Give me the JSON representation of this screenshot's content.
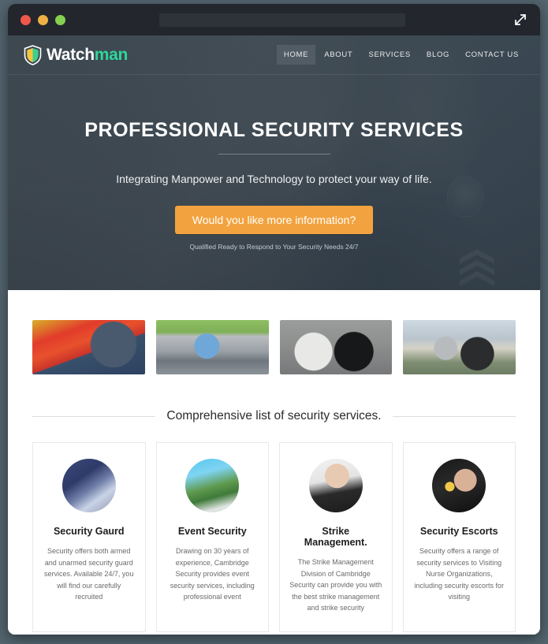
{
  "browser": {
    "traffic_lights": [
      {
        "name": "close",
        "color": "#f0574b"
      },
      {
        "name": "minimize",
        "color": "#eeb044"
      },
      {
        "name": "maximize",
        "color": "#84d04f"
      }
    ],
    "url_value": "",
    "url_placeholder": "",
    "expand_icon": "expand-arrows-icon"
  },
  "site": {
    "logo": {
      "icon": "shield-icon",
      "text_primary": "Watch",
      "text_accent": "man",
      "accent_color": "#2fd69a"
    },
    "nav": [
      {
        "label": "HOME",
        "active": true
      },
      {
        "label": "ABOUT",
        "active": false
      },
      {
        "label": "SERVICES",
        "active": false
      },
      {
        "label": "BLOG",
        "active": false
      },
      {
        "label": "CONTACT US",
        "active": false
      }
    ]
  },
  "hero": {
    "title": "PROFESSIONAL SECURITY SERVICES",
    "subtitle": "Integrating Manpower and Technology to protect your way of life.",
    "cta_label": "Would you like more information?",
    "cta_color": "#f2a33f",
    "note": "Qualified Ready to Respond to Your Security Needs 24/7"
  },
  "gallery": [
    {
      "name": "officer-with-flag-thumbnail"
    },
    {
      "name": "bike-patrol-officer-thumbnail"
    },
    {
      "name": "two-men-sunglasses-thumbnail"
    },
    {
      "name": "officers-overlook-thumbnail"
    }
  ],
  "services_section": {
    "heading": "Comprehensive list of security services.",
    "cards": [
      {
        "image": "security-guard-radio-photo",
        "title": "Security Gaurd",
        "text": "Security offers both armed and unarmed security guard services. Available 24/7, you will find our carefully recruited"
      },
      {
        "image": "cctv-cameras-photo",
        "title": "Event Security",
        "text": "Drawing on 30 years of experience, Cambridge Security provides event security services, including professional event"
      },
      {
        "image": "woman-officer-radio-photo",
        "title": "Strike Management.",
        "text": "The Strike Management Division of Cambridge Security can provide you with the best strike management and strike security"
      },
      {
        "image": "woman-with-device-photo",
        "title": "Security Escorts",
        "text": "Security offers a range of security services to Visiting Nurse Organizations, including security escorts for visiting"
      }
    ]
  }
}
